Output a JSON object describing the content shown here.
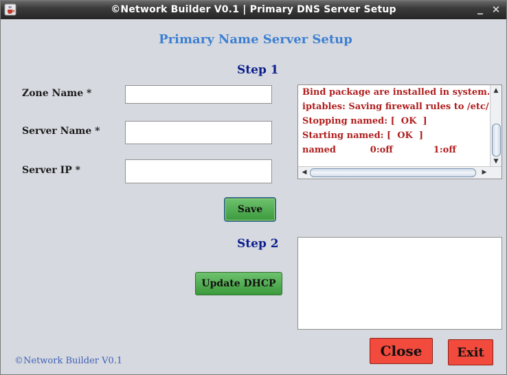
{
  "window": {
    "title": "©Network Builder V0.1 | Primary DNS Server Setup",
    "minimize_glyph": "_",
    "close_glyph": "✕"
  },
  "main": {
    "heading": "Primary Name Server Setup",
    "step1_label": "Step 1",
    "step2_label": "Step 2"
  },
  "form": {
    "zone_name_label": "Zone Name *",
    "zone_name_value": "",
    "server_name_label": "Server Name *",
    "server_name_value": "",
    "server_ip_label": "Server IP *",
    "server_ip_value": ""
  },
  "buttons": {
    "save": "Save",
    "update_dhcp": "Update DHCP",
    "close": "Close",
    "exit": "Exit"
  },
  "log": {
    "text": "Bind package are installed in system.\niptables: Saving firewall rules to /etc/\nStopping named: [  OK  ]\nStarting named: [  OK  ]\nnamed           0:off             1:off"
  },
  "dhcp_output": {
    "text": ""
  },
  "footer": {
    "text": "©Network Builder V0.1"
  },
  "colors": {
    "heading": "#3d7fd2",
    "step": "#0b1e8c",
    "log_text": "#b01e1e",
    "green_button": "#4caf50",
    "red_button": "#f24a3c"
  },
  "icons": {
    "app": "java-cup-icon",
    "scroll_up": "arrow-up-icon",
    "scroll_down": "arrow-down-icon",
    "scroll_left": "arrow-left-icon",
    "scroll_right": "arrow-right-icon"
  }
}
